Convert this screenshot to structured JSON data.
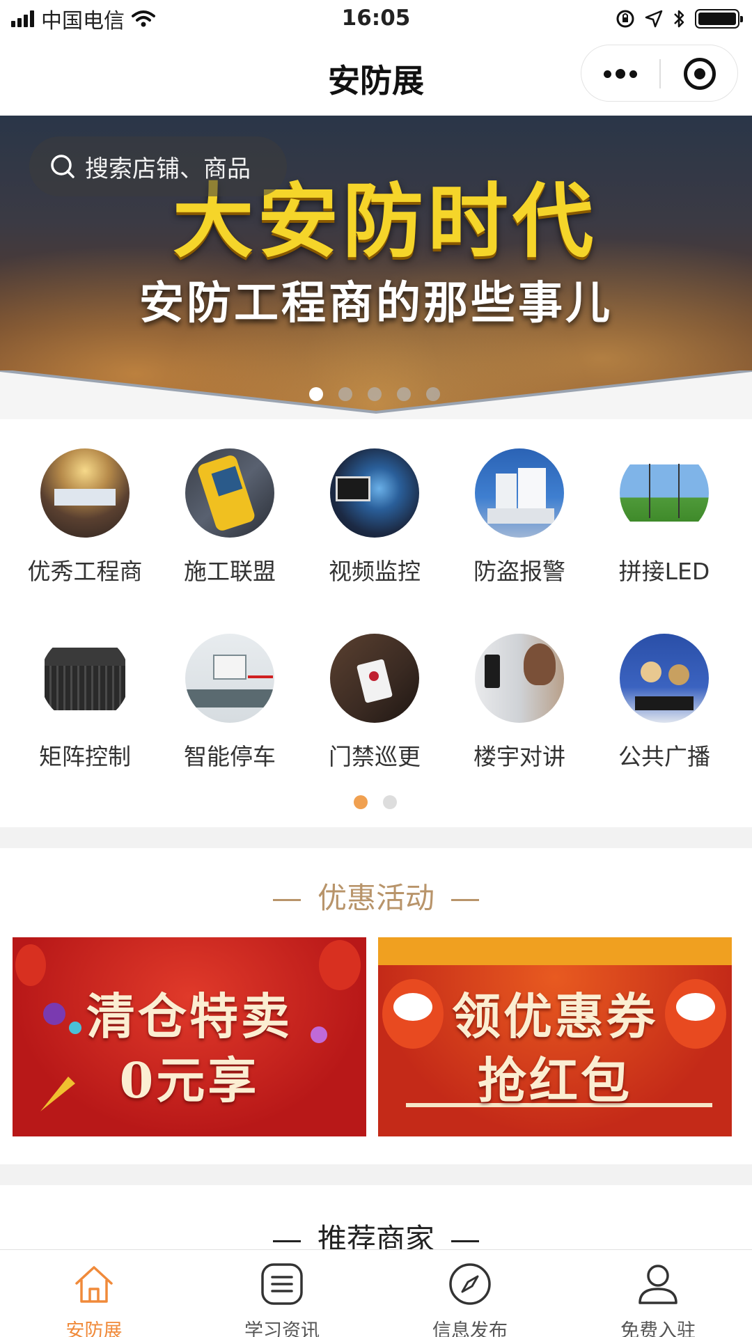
{
  "status_bar": {
    "carrier": "中国电信",
    "time": "16:05"
  },
  "nav": {
    "title": "安防展"
  },
  "search": {
    "placeholder": "搜索店铺、商品"
  },
  "banner": {
    "headline": "大安防时代",
    "subtitle": "安防工程商的那些事儿",
    "slide_count": 5,
    "active_index": 0
  },
  "categories": {
    "items": [
      {
        "label": "优秀工程商",
        "icon": "conference-photo"
      },
      {
        "label": "施工联盟",
        "icon": "network-tester-photo"
      },
      {
        "label": "视频监控",
        "icon": "tablet-globe-photo"
      },
      {
        "label": "防盗报警",
        "icon": "alarm-devices-photo"
      },
      {
        "label": "拼接LED",
        "icon": "video-wall-photo"
      },
      {
        "label": "矩阵控制",
        "icon": "matrix-device-photo"
      },
      {
        "label": "智能停车",
        "icon": "parking-gate-photo"
      },
      {
        "label": "门禁巡更",
        "icon": "access-card-photo"
      },
      {
        "label": "楼宇对讲",
        "icon": "intercom-photo"
      },
      {
        "label": "公共广播",
        "icon": "speakers-photo"
      }
    ],
    "page_count": 2,
    "active_page": 0
  },
  "promotions": {
    "title": "优惠活动",
    "cards": [
      {
        "line1": "清仓特卖",
        "line2": "0元享"
      },
      {
        "line1": "领优惠券",
        "line2": "抢红包"
      }
    ]
  },
  "recommended": {
    "title": "推荐商家"
  },
  "tab_bar": {
    "active_color": "#f08a3a",
    "tabs": [
      {
        "label": "安防展",
        "icon": "home-icon"
      },
      {
        "label": "学习资讯",
        "icon": "list-icon"
      },
      {
        "label": "信息发布",
        "icon": "compass-icon"
      },
      {
        "label": "免费入驻",
        "icon": "user-icon"
      }
    ]
  }
}
